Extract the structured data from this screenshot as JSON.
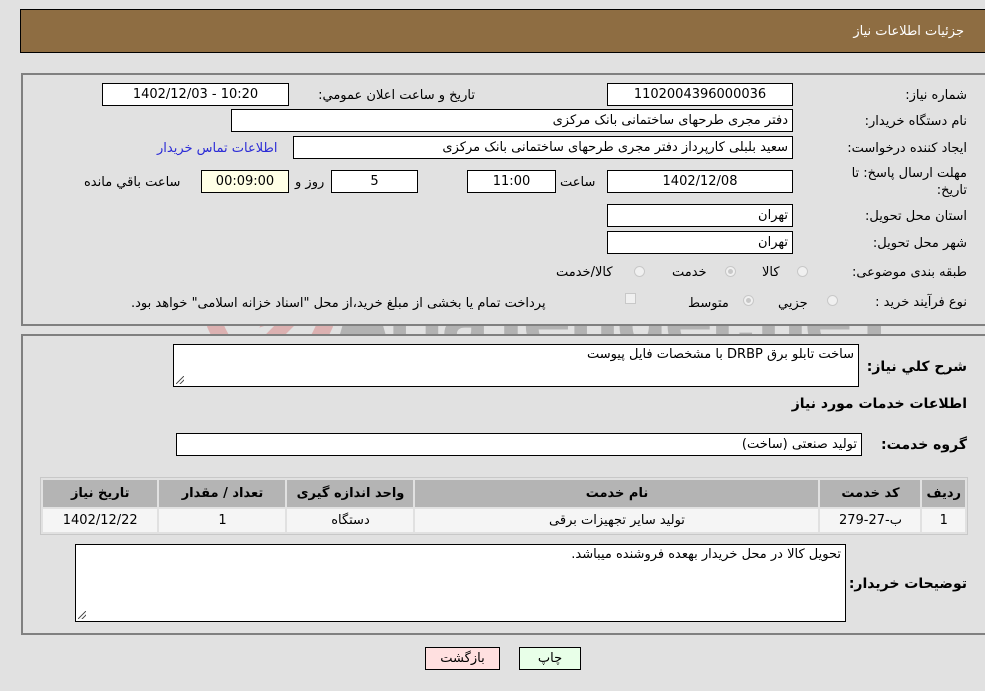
{
  "header": {
    "title": "جزئیات اطلاعات نیاز"
  },
  "fields": {
    "need_number": {
      "label": "شماره نیاز:",
      "value": "1102004396000036"
    },
    "announce_datetime": {
      "label": "تاریخ و ساعت اعلان عمومي:",
      "value": "1402/12/03 - 10:20"
    },
    "buyer_org": {
      "label": "نام دستگاه خریدار:",
      "value": "دفتر مجری طرحهای ساختمانی بانک مرکزی"
    },
    "requester": {
      "label": "ایجاد کننده درخواست:",
      "value": "سعید بلبلی کارپرداز دفتر مجری طرحهای ساختمانی بانک مرکزی"
    },
    "buyer_contact_link": "اطلاعات تماس خریدار",
    "deadline": {
      "label_line1": "مهلت ارسال پاسخ: تا",
      "label_line2": "تاریخ:",
      "date": "1402/12/08",
      "time_label": "ساعت",
      "time": "11:00",
      "days": "5",
      "days_label": "روز و",
      "remaining": "00:09:00",
      "remaining_label": "ساعت باقي مانده"
    },
    "province": {
      "label": "استان محل تحویل:",
      "value": "تهران"
    },
    "city": {
      "label": "شهر محل تحویل:",
      "value": "تهران"
    },
    "category": {
      "label": "طبقه بندی موضوعی:",
      "options": [
        "کالا",
        "خدمت",
        "کالا/خدمت"
      ],
      "selected": "خدمت"
    },
    "purchase_type": {
      "label": "نوع فرآیند خرید :",
      "options": [
        "جزيي",
        "متوسط"
      ],
      "selected": "متوسط",
      "treasury_note": "پرداخت تمام یا بخشی از مبلغ خرید،از محل \"اسناد خزانه اسلامی\" خواهد بود."
    }
  },
  "details": {
    "description_label": "شرح کلي نیاز:",
    "description": "ساخت تابلو برق DRBP با مشخصات فایل پیوست",
    "services_heading": "اطلاعات خدمات مورد نیاز",
    "service_group_label": "گروه خدمت:",
    "service_group": "تولید صنعتی (ساخت)",
    "table": {
      "headers": [
        "ردیف",
        "کد خدمت",
        "نام خدمت",
        "واحد اندازه گیری",
        "تعداد / مقدار",
        "تاریخ نیاز"
      ],
      "rows": [
        [
          "1",
          "ب-27-279",
          "تولید سایر تجهیزات برقی",
          "دستگاه",
          "1",
          "1402/12/22"
        ]
      ]
    },
    "buyer_notes_label": "توضیحات خریدار:",
    "buyer_notes": "تحویل کالا در محل خریدار بهعده فروشنده میباشد."
  },
  "buttons": {
    "print": "چاپ",
    "back": "بازگشت"
  },
  "watermark": "AriaTender.neT"
}
